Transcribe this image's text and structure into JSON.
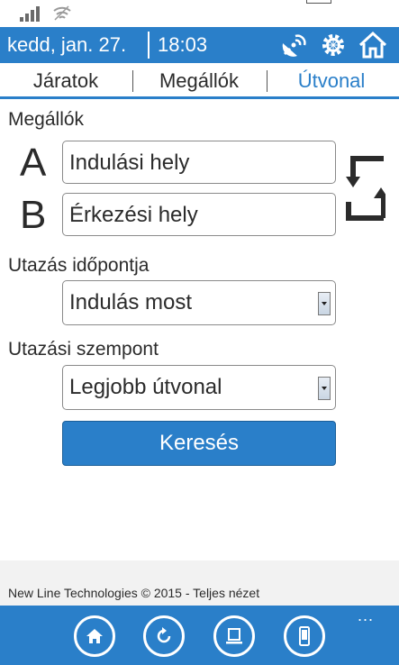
{
  "statusbar": {
    "icons": [
      "signal-icon",
      "wifi-icon"
    ]
  },
  "header": {
    "date": "kedd, jan. 27.",
    "time": "18:03",
    "icons": [
      "radar-icon",
      "gear-icon",
      "home-icon"
    ]
  },
  "tabs": [
    {
      "label": "Járatok",
      "active": false
    },
    {
      "label": "Megállók",
      "active": false
    },
    {
      "label": "Útvonal",
      "active": true
    }
  ],
  "route": {
    "stops_label": "Megállók",
    "from": {
      "letter": "A",
      "placeholder": "Indulási hely"
    },
    "to": {
      "letter": "B",
      "placeholder": "Érkezési hely"
    },
    "swap_icon": "swap-arrows-icon",
    "time_label": "Utazás időpontja",
    "time_value": "Indulás most",
    "criteria_label": "Utazási szempont",
    "criteria_value": "Legjobb útvonal",
    "search_label": "Keresés"
  },
  "footer": {
    "text": "New Line Technologies © 2015 - Teljes nézet"
  },
  "appbar": {
    "buttons": [
      "home-icon",
      "refresh-icon",
      "desktop-icon",
      "phone-icon"
    ],
    "more": "..."
  },
  "colors": {
    "accent": "#2a7fc9",
    "text": "#2b2b2b",
    "footer_bg": "#f2f2f2"
  }
}
